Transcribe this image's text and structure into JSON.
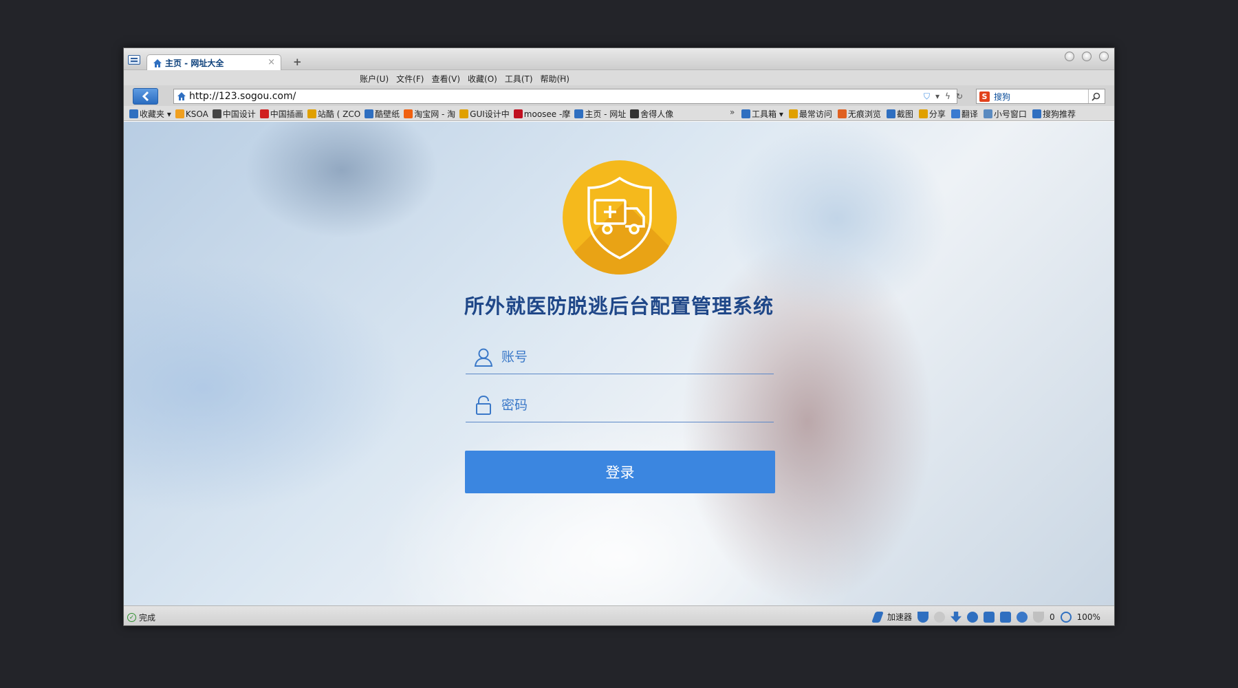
{
  "browser": {
    "tab": {
      "title": "主页 - 网址大全",
      "close": "×"
    },
    "new_tab": "+",
    "menus": [
      "账户(U)",
      "文件(F)",
      "查看(V)",
      "收藏(O)",
      "工具(T)",
      "帮助(H)"
    ],
    "url": "http://123.sogou.com/",
    "search": {
      "logo": "S",
      "text": "搜狗"
    },
    "bookmarks_left": [
      {
        "label": "收藏夹 ▾",
        "color": "#2f6fc0"
      },
      {
        "label": "KSOA",
        "color": "#f0a020"
      },
      {
        "label": "中国设计",
        "color": "#444444"
      },
      {
        "label": "中国插画",
        "color": "#d02020"
      },
      {
        "label": "站酷 ( ZCO",
        "color": "#e0a000"
      },
      {
        "label": "酷壁纸",
        "color": "#2f6fc0"
      },
      {
        "label": "淘宝网 - 淘",
        "color": "#f06010"
      },
      {
        "label": "GUI设计中",
        "color": "#e0a000"
      },
      {
        "label": "moosee -摩",
        "color": "#c01020"
      },
      {
        "label": "主页 - 网址",
        "color": "#2f6fc0"
      },
      {
        "label": "舍得人像",
        "color": "#333333"
      }
    ],
    "bookmarks_overflow": "»",
    "bookmarks_right": [
      {
        "label": "工具箱 ▾",
        "color": "#2f6fc0"
      },
      {
        "label": "最常访问",
        "color": "#e0a000"
      },
      {
        "label": "无痕浏览",
        "color": "#e06020"
      },
      {
        "label": "截图",
        "color": "#2f6fc0"
      },
      {
        "label": "分享",
        "color": "#e0a000"
      },
      {
        "label": "翻译",
        "color": "#3a7ad0"
      },
      {
        "label": "小号窗口",
        "color": "#5a8ac0"
      },
      {
        "label": "搜狗推荐",
        "color": "#2f6fc0"
      }
    ],
    "status": {
      "text": "完成",
      "accelerator": "加速器",
      "count": "0",
      "zoom": "100%"
    }
  },
  "page": {
    "title": "所外就医防脱逃后台配置管理系统",
    "account_placeholder": "账号",
    "password_placeholder": "密码",
    "login_label": "登录",
    "accent": "#3b86e0",
    "logo_color": "#f5b91c"
  }
}
